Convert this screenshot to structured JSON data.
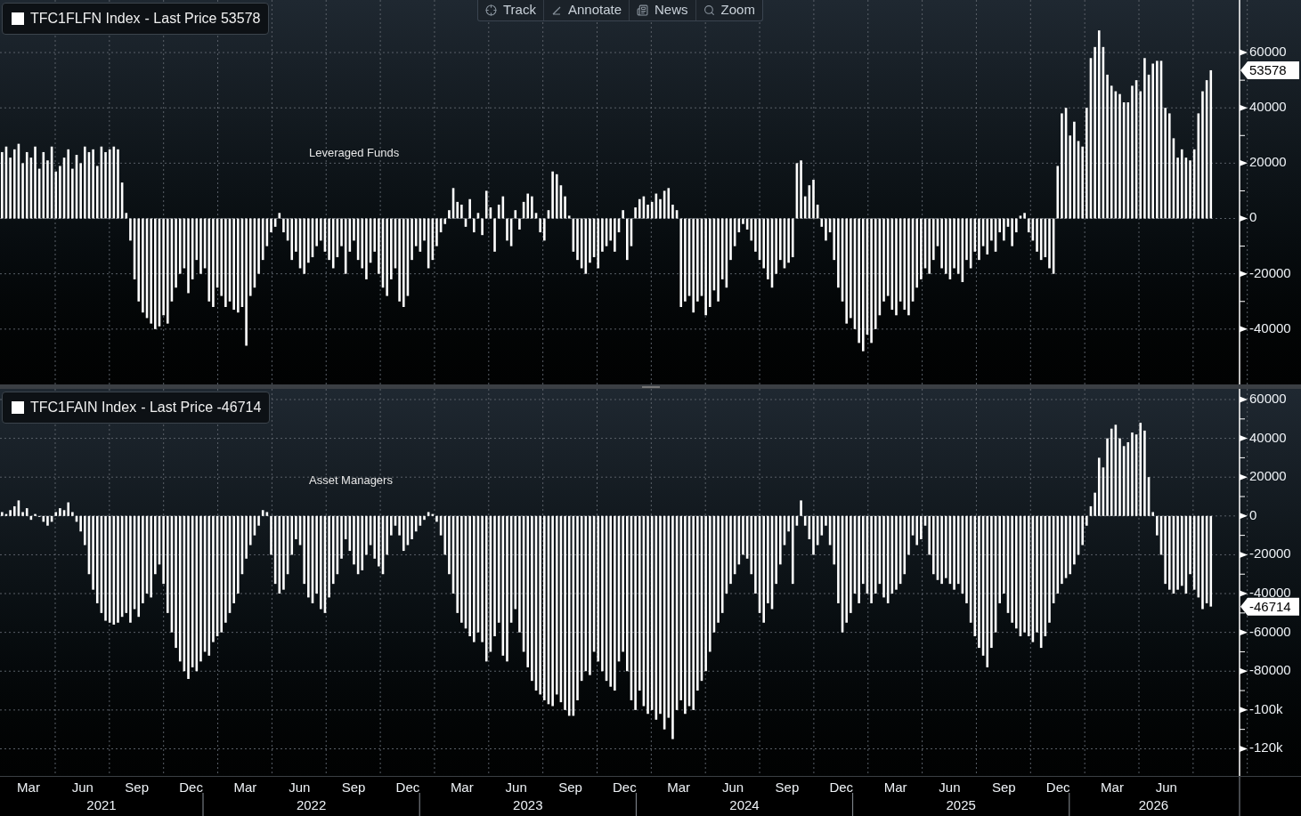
{
  "toolbar": [
    {
      "kind": "track",
      "label": "Track"
    },
    {
      "kind": "annotate",
      "label": "Annotate"
    },
    {
      "kind": "news",
      "label": "News"
    },
    {
      "kind": "zoom",
      "label": "Zoom"
    }
  ],
  "panels": [
    {
      "legend": "- Last Price 53578",
      "last_value_tag": "53578",
      "chart_data": {
        "type": "bar",
        "grid": true,
        "ylim": [
          -60000,
          79000
        ],
        "yticks": [
          -40000,
          -20000,
          0,
          20000,
          40000,
          60000
        ],
        "annotations": [
          "Leveraged Funds"
        ],
        "series": [
          {
            "name": "TFC1FLFN Index",
            "color": "#ffffff",
            "values": [
              24000,
              26000,
              22000,
              25000,
              27000,
              20000,
              24000,
              22000,
              26000,
              18000,
              24000,
              21000,
              26000,
              17000,
              19000,
              22000,
              25000,
              18000,
              23000,
              20000,
              26000,
              24000,
              25000,
              19000,
              26000,
              24000,
              25000,
              26000,
              25000,
              13000,
              2000,
              -8000,
              -22000,
              -30000,
              -34000,
              -36000,
              -38000,
              -40000,
              -39000,
              -35000,
              -38000,
              -30000,
              -25000,
              -20000,
              -18000,
              -27000,
              -22000,
              -15000,
              -20000,
              -18000,
              -30000,
              -32000,
              -25000,
              -28000,
              -32000,
              -30000,
              -33000,
              -34000,
              -32000,
              -46000,
              -28000,
              -25000,
              -20000,
              -15000,
              -10000,
              -5000,
              -3000,
              2000,
              -5000,
              -8000,
              -15000,
              -12000,
              -18000,
              -20000,
              -16000,
              -14000,
              -10000,
              -8000,
              -12000,
              -15000,
              -18000,
              -14000,
              -10000,
              -20000,
              -12000,
              -8000,
              -15000,
              -18000,
              -22000,
              -16000,
              -12000,
              -20000,
              -25000,
              -28000,
              -22000,
              -18000,
              -30000,
              -32000,
              -28000,
              -15000,
              -10000,
              -12000,
              -8000,
              -18000,
              -15000,
              -10000,
              -5000,
              -2000,
              3000,
              11000,
              6000,
              5000,
              -3000,
              7000,
              -5000,
              2000,
              -6000,
              10000,
              4000,
              -12000,
              5000,
              8000,
              -8000,
              -10000,
              3000,
              -4000,
              6000,
              9000,
              8000,
              2000,
              -5000,
              -8000,
              3000,
              17000,
              16000,
              12000,
              8000,
              1000,
              -12000,
              -15000,
              -18000,
              -20000,
              -16000,
              -14000,
              -18000,
              -12000,
              -10000,
              -8000,
              -12000,
              -5000,
              3000,
              -15000,
              -10000,
              4000,
              7000,
              8000,
              5000,
              6000,
              9000,
              7000,
              10000,
              11000,
              5000,
              3000,
              -32000,
              -30000,
              -28000,
              -34000,
              -30000,
              -28000,
              -35000,
              -32000,
              -26000,
              -30000,
              -22000,
              -25000,
              -15000,
              -10000,
              -5000,
              -2000,
              -4000,
              -8000,
              -12000,
              -15000,
              -18000,
              -22000,
              -25000,
              -20000,
              -15000,
              -18000,
              -16000,
              -14000,
              20000,
              21000,
              8000,
              12000,
              14000,
              5000,
              -3000,
              -8000,
              -5000,
              -15000,
              -25000,
              -30000,
              -38000,
              -36000,
              -40000,
              -45000,
              -48000,
              -42000,
              -45000,
              -40000,
              -35000,
              -30000,
              -28000,
              -33000,
              -35000,
              -30000,
              -33000,
              -35000,
              -30000,
              -25000,
              -22000,
              -18000,
              -20000,
              -15000,
              -10000,
              -18000,
              -20000,
              -22000,
              -18000,
              -20000,
              -23000,
              -15000,
              -18000,
              -12000,
              -15000,
              -10000,
              -13000,
              -8000,
              -12000,
              -5000,
              -8000,
              -3000,
              -10000,
              -5000,
              1000,
              2000,
              -5000,
              -8000,
              -12000,
              -15000,
              -14000,
              -18000,
              -20000,
              19000,
              38000,
              40000,
              30000,
              35000,
              28000,
              26000,
              40000,
              58000,
              62000,
              68000,
              62000,
              52000,
              48000,
              46000,
              45000,
              42000,
              42000,
              48000,
              50000,
              46000,
              58000,
              52000,
              56000,
              57000,
              57000,
              40000,
              38000,
              29000,
              22000,
              25000,
              22000,
              21000,
              25000,
              38000,
              46000,
              50000,
              53600,
              null,
              null,
              null,
              null,
              null,
              null
            ]
          }
        ]
      }
    },
    {
      "legend": "- Last Price -46714",
      "last_value_tag": "-46714",
      "chart_data": {
        "type": "bar",
        "grid": true,
        "ylim": [
          -134000,
          65500
        ],
        "yticks": [
          {
            "value": -120000,
            "label": "-120k"
          },
          {
            "value": -100000,
            "label": "-100k"
          },
          -80000,
          -60000,
          -40000,
          -20000,
          0,
          20000,
          40000,
          60000
        ],
        "annotations": [
          "Asset Managers"
        ],
        "series": [
          {
            "name": "TFC1FAIN Index",
            "color": "#ffffff",
            "values": [
              2000,
              1000,
              3000,
              5000,
              8000,
              2000,
              4000,
              -2000,
              1000,
              0,
              -3000,
              -5000,
              -3000,
              2000,
              4000,
              3000,
              7000,
              2000,
              -3000,
              -8000,
              -15000,
              -30000,
              -38000,
              -45000,
              -50000,
              -54000,
              -55000,
              -56000,
              -55000,
              -52000,
              -50000,
              -55000,
              -48000,
              -52000,
              -45000,
              -40000,
              -42000,
              -30000,
              -25000,
              -35000,
              -50000,
              -60000,
              -68000,
              -75000,
              -80000,
              -84000,
              -78000,
              -80000,
              -75000,
              -70000,
              -72000,
              -65000,
              -62000,
              -60000,
              -55000,
              -50000,
              -45000,
              -40000,
              -30000,
              -22000,
              -15000,
              -10000,
              -5000,
              3000,
              2000,
              -20000,
              -35000,
              -40000,
              -38000,
              -30000,
              -20000,
              -12000,
              -15000,
              -35000,
              -42000,
              -45000,
              -40000,
              -48000,
              -50000,
              -42000,
              -35000,
              -30000,
              -22000,
              -12000,
              -18000,
              -25000,
              -30000,
              -28000,
              -20000,
              -15000,
              -22000,
              -26000,
              -30000,
              -20000,
              -10000,
              -5000,
              -10000,
              -18000,
              -15000,
              -12000,
              -8000,
              -5000,
              -2000,
              2000,
              1000,
              -3000,
              -10000,
              -20000,
              -30000,
              -40000,
              -50000,
              -55000,
              -58000,
              -62000,
              -65000,
              -60000,
              -65000,
              -75000,
              -70000,
              -62000,
              -55000,
              -72000,
              -75000,
              -55000,
              -48000,
              -60000,
              -70000,
              -78000,
              -85000,
              -90000,
              -92000,
              -95000,
              -97000,
              -98000,
              -92000,
              -96000,
              -100000,
              -103000,
              -103000,
              -95000,
              -85000,
              -80000,
              -82000,
              -70000,
              -75000,
              -80000,
              -85000,
              -88000,
              -90000,
              -75000,
              -70000,
              -80000,
              -95000,
              -100000,
              -90000,
              -98000,
              -102000,
              -100000,
              -105000,
              -102000,
              -110000,
              -104000,
              -115000,
              -100000,
              -95000,
              -102000,
              -98000,
              -100000,
              -90000,
              -85000,
              -80000,
              -70000,
              -60000,
              -55000,
              -50000,
              -40000,
              -35000,
              -30000,
              -25000,
              -20000,
              -22000,
              -30000,
              -40000,
              -50000,
              -55000,
              -45000,
              -48000,
              -35000,
              -25000,
              -15000,
              -8000,
              -35000,
              -5000,
              8000,
              -5000,
              -12000,
              -20000,
              -15000,
              -10000,
              -5000,
              -15000,
              -25000,
              -45000,
              -60000,
              -55000,
              -50000,
              -40000,
              -45000,
              -35000,
              -40000,
              -45000,
              -40000,
              -35000,
              -42000,
              -45000,
              -40000,
              -38000,
              -35000,
              -30000,
              -20000,
              -10000,
              -15000,
              -12000,
              -5000,
              -20000,
              -30000,
              -33000,
              -35000,
              -32000,
              -35000,
              -38000,
              -35000,
              -40000,
              -45000,
              -55000,
              -62000,
              -68000,
              -72000,
              -78000,
              -68000,
              -60000,
              -45000,
              -40000,
              -50000,
              -55000,
              -58000,
              -62000,
              -60000,
              -62000,
              -65000,
              -60000,
              -68000,
              -62000,
              -55000,
              -45000,
              -40000,
              -35000,
              -32000,
              -30000,
              -25000,
              -20000,
              -15000,
              -5000,
              5000,
              12000,
              30000,
              25000,
              40000,
              45000,
              47000,
              40000,
              36000,
              38000,
              43000,
              42000,
              48000,
              44000,
              20000,
              2000,
              -10000,
              -20000,
              -35000,
              -38000,
              -40000,
              -38000,
              -36000,
              -40000,
              -30000,
              -38000,
              -42000,
              -48000,
              -45000,
              -46700,
              null,
              null,
              null,
              null,
              null,
              null
            ]
          }
        ]
      }
    }
  ],
  "time_axis": {
    "months": [
      "Mar",
      "Jun",
      "Sep",
      "Dec",
      "Mar",
      "Jun",
      "Sep",
      "Dec",
      "Mar",
      "Jun",
      "Sep",
      "Dec",
      "Mar",
      "Jun",
      "Sep",
      "Dec",
      "Mar",
      "Jun",
      "Sep",
      "Dec",
      "Mar",
      "Jun"
    ],
    "years": [
      "2021",
      "2022",
      "2023",
      "2024",
      "2025",
      "2026"
    ]
  }
}
